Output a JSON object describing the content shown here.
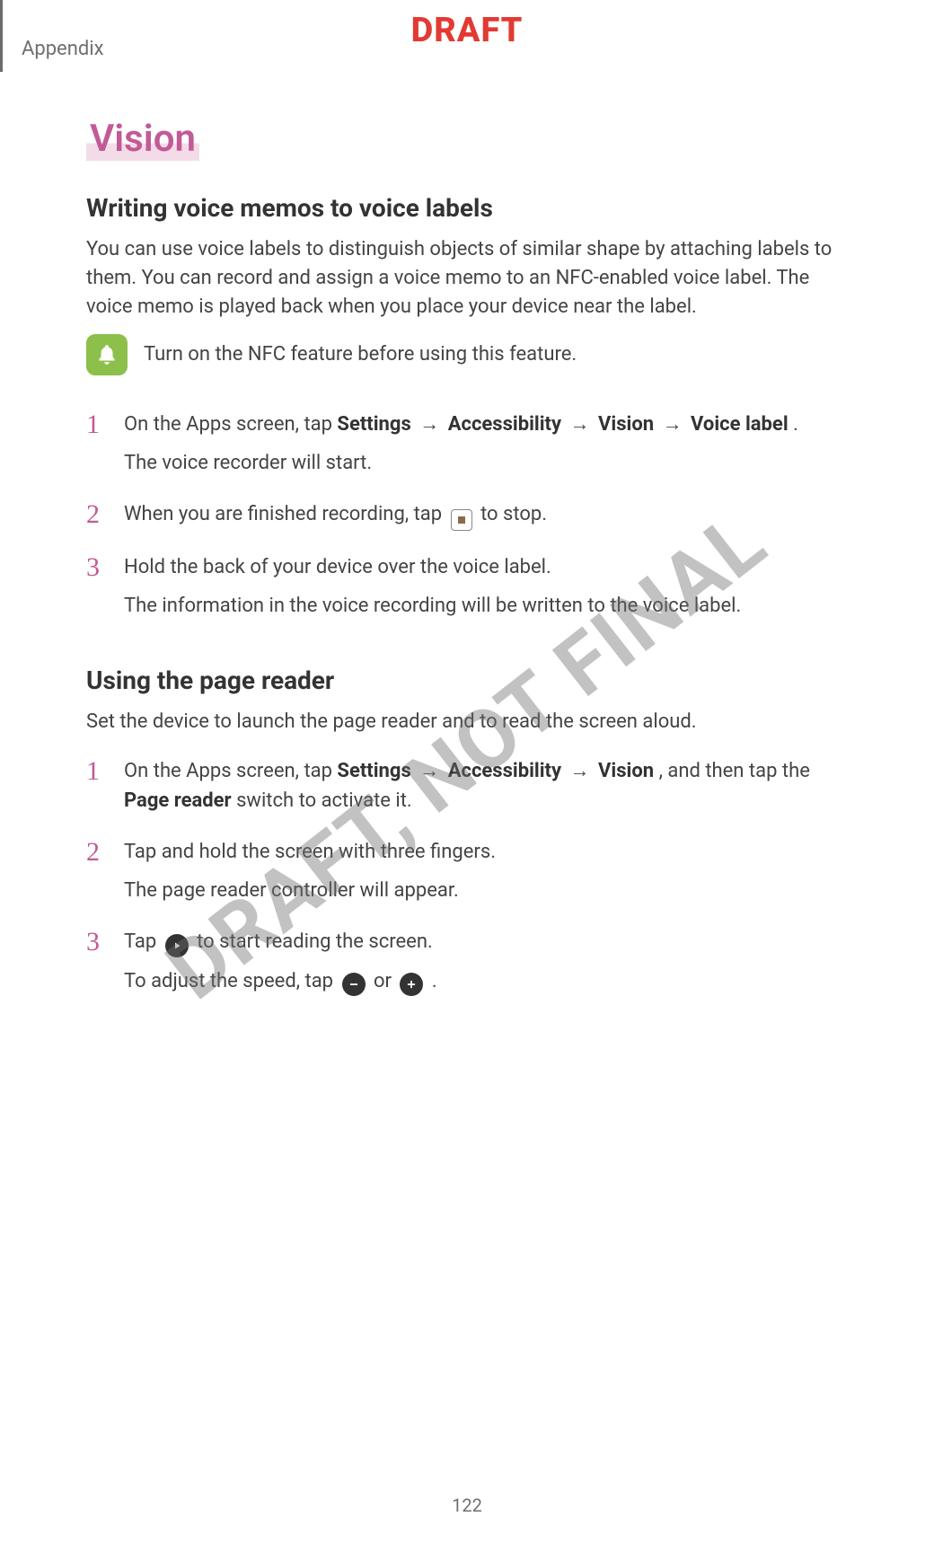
{
  "header": {
    "appendix": "Appendix",
    "draft": "DRAFT"
  },
  "watermark": "DRAFT, NOT FINAL",
  "page_number": "122",
  "section_title": "Vision",
  "voice_labels": {
    "heading": "Writing voice memos to voice labels",
    "intro": "You can use voice labels to distinguish objects of similar shape by attaching labels to them. You can record and assign a voice memo to an NFC-enabled voice label. The voice memo is played back when you place your device near the label.",
    "note": "Turn on the NFC feature before using this feature.",
    "steps": {
      "s1a": "On the Apps screen, tap ",
      "s1_settings": "Settings",
      "s1_accessibility": "Accessibility",
      "s1_vision": "Vision",
      "s1_voice_label": "Voice label",
      "s1_period": ".",
      "s1b": "The voice recorder will start.",
      "s2a": "When you are finished recording, tap",
      "s2b": "to stop.",
      "s3a": "Hold the back of your device over the voice label.",
      "s3b": "The information in the voice recording will be written to the voice label."
    }
  },
  "page_reader": {
    "heading": "Using the page reader",
    "intro": "Set the device to launch the page reader and to read the screen aloud.",
    "steps": {
      "s1a": "On the Apps screen, tap ",
      "s1_settings": "Settings",
      "s1_accessibility": "Accessibility",
      "s1_vision": "Vision",
      "s1b": ", and then tap the ",
      "s1_page_reader": "Page reader",
      "s1c": " switch to activate it.",
      "s2a": "Tap and hold the screen with three fingers.",
      "s2b": "The page reader controller will appear.",
      "s3a": "Tap",
      "s3b": "to start reading the screen.",
      "s3c": "To adjust the speed, tap",
      "s3_or": "or",
      "s3_period": "."
    }
  },
  "arrow": "→"
}
